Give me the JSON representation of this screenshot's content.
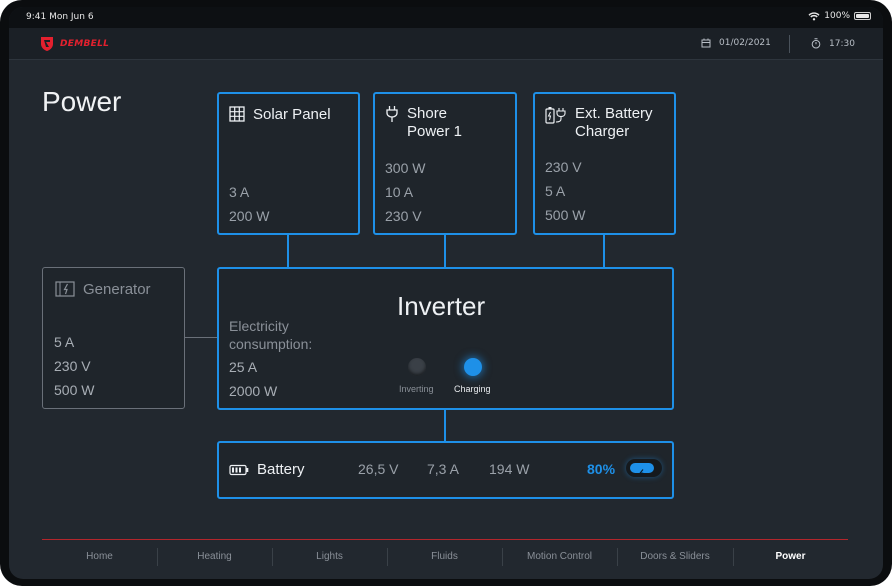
{
  "status_bar": {
    "time": "9:41 Mon Jun 6",
    "battery": "100%"
  },
  "header": {
    "brand": "DEMBELL",
    "date": "01/02/2021",
    "timer": "17:30"
  },
  "page": {
    "title": "Power"
  },
  "sources": {
    "solar": {
      "title": "Solar Panel",
      "values": [
        "3 A",
        "200 W"
      ]
    },
    "shore": {
      "title_line1": "Shore",
      "title_line2": "Power 1",
      "values": [
        "300 W",
        "10 A",
        "230 V"
      ]
    },
    "ext_charger": {
      "title_line1": "Ext. Battery",
      "title_line2": "Charger",
      "values": [
        "230 V",
        "5 A",
        "500 W"
      ]
    },
    "generator": {
      "title": "Generator",
      "values": [
        "5 A",
        "230 V",
        "500 W"
      ]
    }
  },
  "inverter": {
    "title": "Inverter",
    "consumption_line1": "Electricity",
    "consumption_line2": "consumption:",
    "values": [
      "25 A",
      "2000 W"
    ],
    "modes": [
      {
        "label": "Inverting",
        "active": false
      },
      {
        "label": "Charging",
        "active": true
      }
    ]
  },
  "battery": {
    "title": "Battery",
    "voltage": "26,5 V",
    "current": "7,3 A",
    "power": "194 W",
    "percent": "80%"
  },
  "nav": {
    "items": [
      "Home",
      "Heating",
      "Lights",
      "Fluids",
      "Motion Control",
      "Doors & Sliders",
      "Power"
    ],
    "active": "Power"
  },
  "colors": {
    "accent": "#1e90e8",
    "brand": "#e4202e",
    "background": "#22282f"
  }
}
